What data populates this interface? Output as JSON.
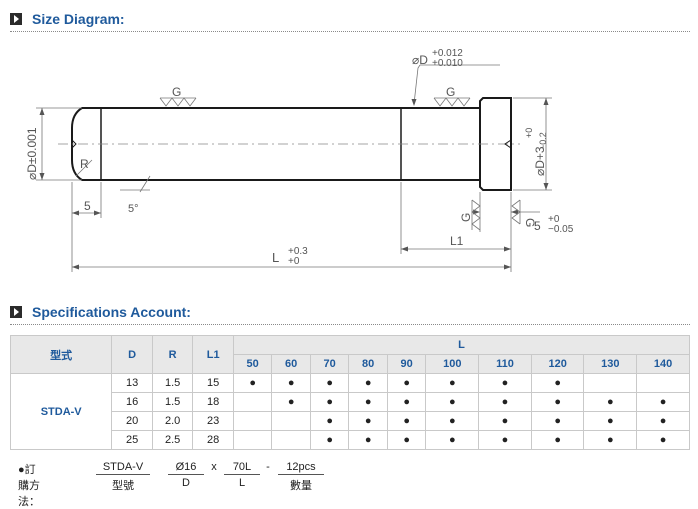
{
  "size_diagram": {
    "title": "Size Diagram:",
    "labels": {
      "d_top_tol_plus": "+0.012",
      "d_top_tol_minus": "+0.010",
      "d_top": "⌀D",
      "g": "G",
      "d_left": "⌀D±0.001",
      "r": "R",
      "dim_5": "5",
      "deg": "5°",
      "l1": "L1",
      "l": "L",
      "l_tol_plus": "+0.3",
      "l_tol_minus": "+0",
      "d3": "⌀D+3",
      "d3_tol_plus": "+0",
      "d3_tol_minus": "−0.2",
      "head_5": "5",
      "head_tol_plus": "+0",
      "head_tol_minus": "−0.05"
    }
  },
  "specifications": {
    "title": "Specifications Account:",
    "headers": {
      "model": "型式",
      "d": "D",
      "r": "R",
      "l1": "L1",
      "l": "L"
    },
    "l_values": [
      "50",
      "60",
      "70",
      "80",
      "90",
      "100",
      "110",
      "120",
      "130",
      "140"
    ],
    "model_name": "STDA-V",
    "rows": [
      {
        "d": "13",
        "r": "1.5",
        "l1": "15",
        "marks": [
          "●",
          "●",
          "●",
          "●",
          "●",
          "●",
          "●",
          "●",
          "",
          ""
        ]
      },
      {
        "d": "16",
        "r": "1.5",
        "l1": "18",
        "marks": [
          "",
          "●",
          "●",
          "●",
          "●",
          "●",
          "●",
          "●",
          "●",
          "●"
        ]
      },
      {
        "d": "20",
        "r": "2.0",
        "l1": "23",
        "marks": [
          "",
          "",
          "●",
          "●",
          "●",
          "●",
          "●",
          "●",
          "●",
          "●"
        ]
      },
      {
        "d": "25",
        "r": "2.5",
        "l1": "28",
        "marks": [
          "",
          "",
          "●",
          "●",
          "●",
          "●",
          "●",
          "●",
          "●",
          "●"
        ]
      }
    ]
  },
  "order_method": {
    "label": "●訂購方法：",
    "example": {
      "model": "STDA-V",
      "d": "Ø16",
      "l": "70L",
      "qty": "12pcs"
    },
    "captions": {
      "model": "型號",
      "d": "D",
      "l": "L",
      "qty": "數量"
    },
    "separators": {
      "x": "x",
      "dash": "-"
    }
  }
}
